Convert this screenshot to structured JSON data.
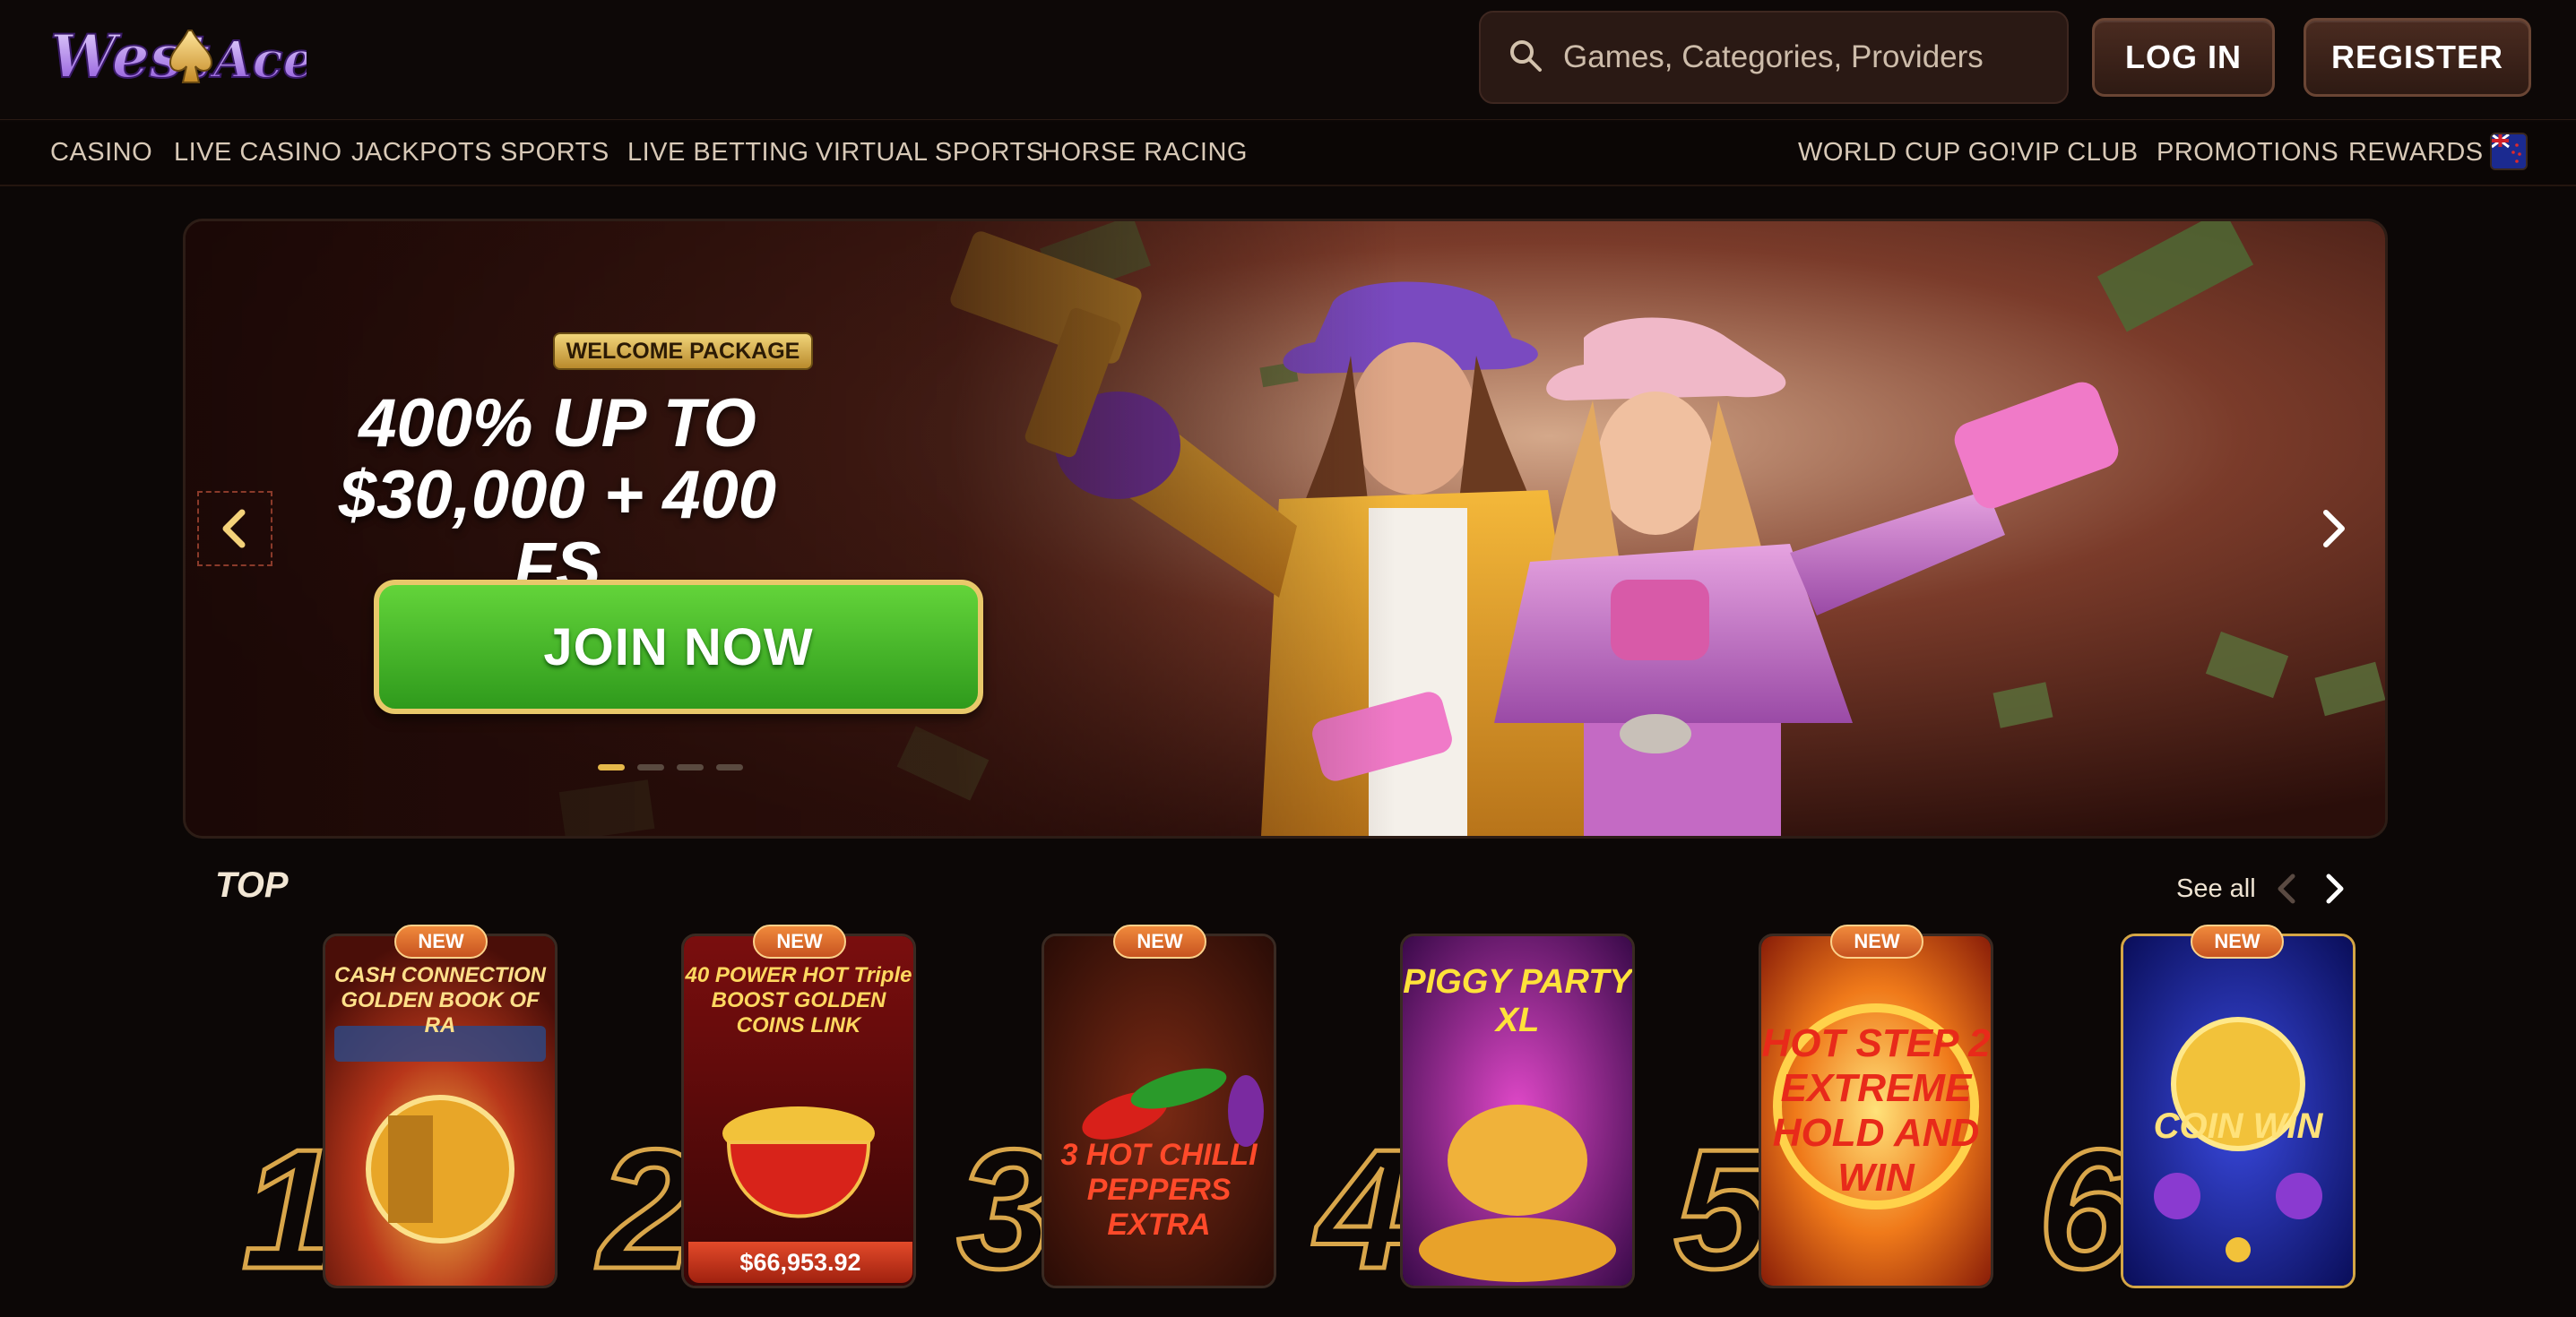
{
  "brand": {
    "logo_text": "West Ace"
  },
  "search": {
    "placeholder": "Games, Categories, Providers"
  },
  "header": {
    "login_label": "LOG IN",
    "register_label": "REGISTER"
  },
  "nav": {
    "left": [
      "CASINO",
      "LIVE CASINO",
      "JACKPOTS",
      "SPORTS",
      "LIVE BETTING",
      "VIRTUAL SPORTS",
      "HORSE RACING"
    ],
    "right": [
      "WORLD CUP GO!",
      "VIP CLUB",
      "PROMOTIONS",
      "REWARDS"
    ]
  },
  "banner": {
    "badge": "WELCOME PACKAGE",
    "headline_line1": "400% UP TO",
    "headline_line2": "$30,000 + 400 FS",
    "cta": "JOIN NOW",
    "slides": 4,
    "active_slide": 1
  },
  "top_section": {
    "title": "TOP",
    "see_all": "See all",
    "games": [
      {
        "rank": "1",
        "badge": "NEW",
        "title": "CASH CONNECTION GOLDEN BOOK OF RA"
      },
      {
        "rank": "2",
        "badge": "NEW",
        "title": "40 POWER HOT Triple BOOST GOLDEN COINS LINK",
        "jackpot": "$66,953.92"
      },
      {
        "rank": "3",
        "badge": "NEW",
        "title": "3 HOT CHILLI PEPPERS EXTRA"
      },
      {
        "rank": "4",
        "badge": "",
        "title": "PIGGY PARTY XL"
      },
      {
        "rank": "5",
        "badge": "NEW",
        "title": "HOT STEP 2 EXTREME HOLD AND WIN"
      },
      {
        "rank": "6",
        "badge": "NEW",
        "title": "COIN WIN"
      }
    ]
  },
  "colors": {
    "accent_gold": "#d9a64a",
    "cta_green": "#3fb62a",
    "badge_orange": "#e0702e",
    "background": "#0c0706"
  }
}
